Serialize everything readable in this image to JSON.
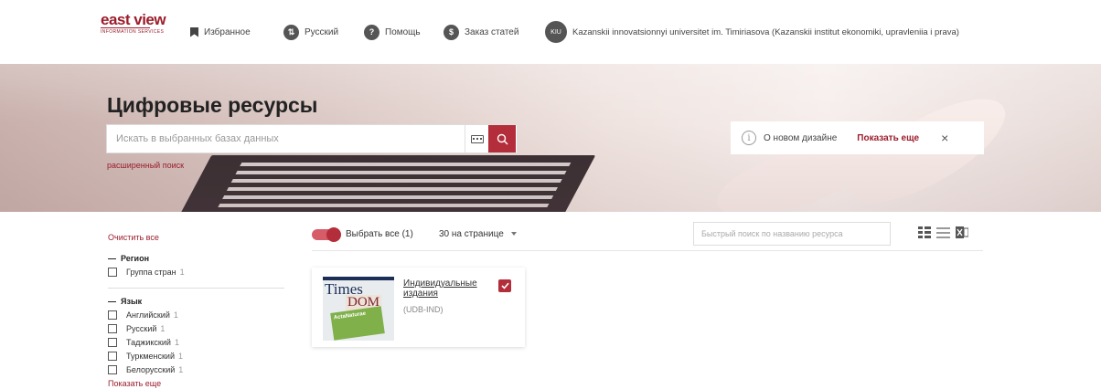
{
  "header": {
    "logo_text": "east view",
    "logo_subtext": "INFORMATION SERVICES",
    "favorites_label": "Избранное",
    "language_label": "Русский",
    "help_label": "Помощь",
    "orders_label": "Заказ статей",
    "institution_initials": "KIU",
    "institution_name": "Kazanskii innovatsionnyi universitet im. Timiriasova (Kazanskii institut ekonomiki, upravleniia i prava)"
  },
  "hero": {
    "title": "Цифровые ресурсы",
    "search_placeholder": "Искать в выбранных базах данных",
    "advanced_search": "расширенный поиск",
    "notice_text": "О новом дизайне",
    "notice_show_more": "Показать еще",
    "notice_close": "×"
  },
  "filters": {
    "clear_all": "Очистить все",
    "region_title": "Регион",
    "region_items": [
      {
        "label": "Группа стран",
        "count": "1"
      }
    ],
    "language_title": "Язык",
    "language_items": [
      {
        "label": "Английский",
        "count": "1"
      },
      {
        "label": "Русский",
        "count": "1"
      },
      {
        "label": "Таджикский",
        "count": "1"
      },
      {
        "label": "Туркменский",
        "count": "1"
      },
      {
        "label": "Белорусский",
        "count": "1"
      }
    ],
    "show_more": "Показать еще"
  },
  "toolbar": {
    "select_all": "Выбрать все (1)",
    "per_page": "30 на странице",
    "quick_search_placeholder": "Быстрый поиск по названию ресурса"
  },
  "results": [
    {
      "title": "Индивидуальные издания",
      "code": "(UDB-IND)",
      "thumb_texts": [
        "Times",
        "DOM",
        "ActaNaturae"
      ]
    }
  ],
  "colors": {
    "accent": "#b32d3a",
    "link": "#9c1c2b"
  }
}
